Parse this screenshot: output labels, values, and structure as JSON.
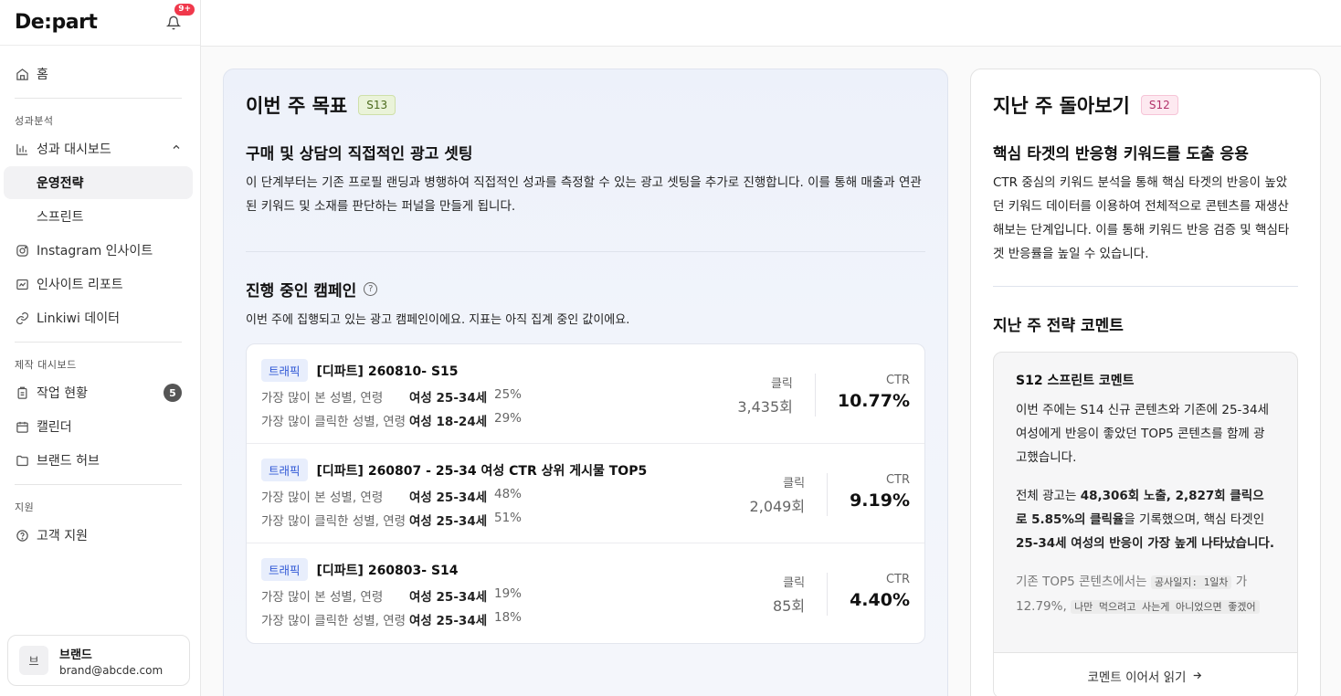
{
  "app": {
    "logo": "De:part",
    "notification_badge": "9+"
  },
  "sidebar": {
    "home": "홈",
    "section_performance": "성과분석",
    "dashboard": "성과 대시보드",
    "strategy": "운영전략",
    "sprint": "스프린트",
    "instagram": "Instagram 인사이트",
    "insight_report": "인사이트 리포트",
    "linkiwi": "Linkiwi 데이터",
    "section_production": "제작 대시보드",
    "work_status": "작업 현황",
    "work_count": "5",
    "calendar": "캘린더",
    "brand_hub": "브랜드 허브",
    "section_support": "지원",
    "customer_support": "고객 지원"
  },
  "profile": {
    "avatar_letter": "브",
    "name": "브랜드",
    "email": "brand@abcde.com"
  },
  "goal": {
    "title": "이번 주 목표",
    "tag": "S13",
    "subtitle": "구매 및 상담의 직접적인 광고 셋팅",
    "description": "이 단계부터는 기존 프로필 랜딩과 병행하여 직접적인 성과를 측정할 수 있는 광고 셋팅을 추가로 진행합니다. 이를 통해 매출과 연관된 키워드 및 소재를 판단하는 퍼널을 만들게 됩니다."
  },
  "campaigns": {
    "title": "진행 중인 캠페인",
    "description": "이번 주에 집행되고 있는 광고 캠페인이에요. 지표는 아직 집계 중인 값이에요.",
    "label_view": "가장 많이 본 성별, 연령",
    "label_click": "가장 많이 클릭한 성별, 연령",
    "label_clicks": "클릭",
    "label_ctr": "CTR",
    "items": [
      {
        "tag": "트래픽",
        "name": "[디파트] 260810- S15",
        "view_group": "여성 25-34세",
        "view_pct": "25%",
        "click_group": "여성 18-24세",
        "click_pct": "29%",
        "clicks": "3,435회",
        "ctr": "10.77%"
      },
      {
        "tag": "트래픽",
        "name": "[디파트] 260807 - 25-34 여성 CTR 상위 게시물 TOP5",
        "view_group": "여성 25-34세",
        "view_pct": "48%",
        "click_group": "여성 25-34세",
        "click_pct": "51%",
        "clicks": "2,049회",
        "ctr": "9.19%"
      },
      {
        "tag": "트래픽",
        "name": "[디파트] 260803- S14",
        "view_group": "여성 25-34세",
        "view_pct": "19%",
        "click_group": "여성 25-34세",
        "click_pct": "18%",
        "clicks": "85회",
        "ctr": "4.40%"
      }
    ]
  },
  "review": {
    "title": "지난 주 돌아보기",
    "tag": "S12",
    "subtitle": "핵심 타겟의 반응형 키워드를 도출 응용",
    "description": "CTR 중심의 키워드 분석을 통해 핵심 타겟의 반응이 높았던 키워드 데이터를 이용하여 전체적으로 콘텐츠를 재생산해보는 단계입니다. 이를 통해 키워드 반응 검증 및 핵심타겟 반응률을 높일 수 있습니다.",
    "comment_section_title": "지난 주 전략 코멘트",
    "comment_title": "S12 스프린트 코멘트",
    "comment_p1": "이번 주에는 S14 신규 콘텐츠와 기존에 25-34세 여성에게 반응이 좋았던 TOP5 콘텐츠를 함께 광고했습니다.",
    "comment_p2_a": "전체 광고는 ",
    "comment_p2_b": "48,306회 노출, 2,827회 클릭으로 5.85%의 클릭율",
    "comment_p2_c": "을 기록했으며, 핵심 타겟인 ",
    "comment_p2_d": "25-34세 여성의 반응이 가장 높게 나타났습니다.",
    "comment_p3_a": "기존 TOP5 콘텐츠에서는 ",
    "comment_p3_code1": "공사일지: 1일차",
    "comment_p3_b": " 가 12.79%, ",
    "comment_p3_code2": "나만 먹으려고 사는게 아니었으면 좋겠어",
    "read_more": "코멘트 이어서 읽기"
  },
  "colors": {
    "accent_blue": "#3159d6",
    "badge_red": "#f0384b"
  }
}
